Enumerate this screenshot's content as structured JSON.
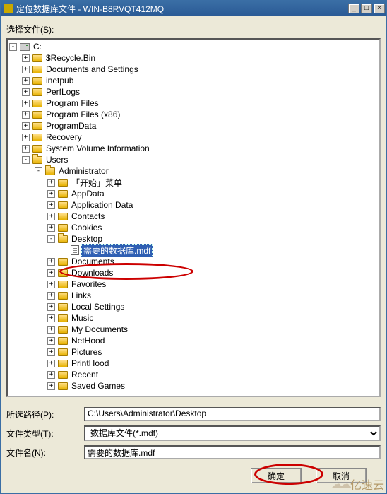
{
  "title": "定位数据库文件 - WIN-B8RVQT412MQ",
  "winbtns": {
    "min": "_",
    "max": "□",
    "close": "×"
  },
  "select_files_label": "选择文件(S):",
  "tree": {
    "root": {
      "label": "C:",
      "type": "drive",
      "expanded": true
    },
    "level1": [
      {
        "label": "$Recycle.Bin",
        "expanded": false
      },
      {
        "label": "Documents and Settings",
        "expanded": false
      },
      {
        "label": "inetpub",
        "expanded": false
      },
      {
        "label": "PerfLogs",
        "expanded": false
      },
      {
        "label": "Program Files",
        "expanded": false
      },
      {
        "label": "Program Files (x86)",
        "expanded": false
      },
      {
        "label": "ProgramData",
        "expanded": false
      },
      {
        "label": "Recovery",
        "expanded": false
      },
      {
        "label": "System Volume Information",
        "expanded": false
      },
      {
        "label": "Users",
        "expanded": true
      }
    ],
    "users_children": [
      {
        "label": "Administrator",
        "expanded": true
      }
    ],
    "admin_children": [
      {
        "label": "「开始」菜单",
        "expanded": false
      },
      {
        "label": "AppData",
        "expanded": false
      },
      {
        "label": "Application Data",
        "expanded": false
      },
      {
        "label": "Contacts",
        "expanded": false
      },
      {
        "label": "Cookies",
        "expanded": false
      },
      {
        "label": "Desktop",
        "expanded": true
      },
      {
        "label": "Documents",
        "expanded": false
      },
      {
        "label": "Downloads",
        "expanded": false
      },
      {
        "label": "Favorites",
        "expanded": false
      },
      {
        "label": "Links",
        "expanded": false
      },
      {
        "label": "Local Settings",
        "expanded": false
      },
      {
        "label": "Music",
        "expanded": false
      },
      {
        "label": "My Documents",
        "expanded": false
      },
      {
        "label": "NetHood",
        "expanded": false
      },
      {
        "label": "Pictures",
        "expanded": false
      },
      {
        "label": "PrintHood",
        "expanded": false
      },
      {
        "label": "Recent",
        "expanded": false
      },
      {
        "label": "Saved Games",
        "expanded": false
      }
    ],
    "desktop_children": [
      {
        "label": "需要的数据库.mdf",
        "type": "file",
        "selected": true
      }
    ]
  },
  "form": {
    "path_label": "所选路径(P):",
    "path_value": "C:\\Users\\Administrator\\Desktop",
    "type_label": "文件类型(T):",
    "type_value": "数据库文件(*.mdf)",
    "name_label": "文件名(N):",
    "name_value": "需要的数据库.mdf"
  },
  "buttons": {
    "ok": "确定",
    "cancel": "取消"
  },
  "watermark": "亿速云"
}
